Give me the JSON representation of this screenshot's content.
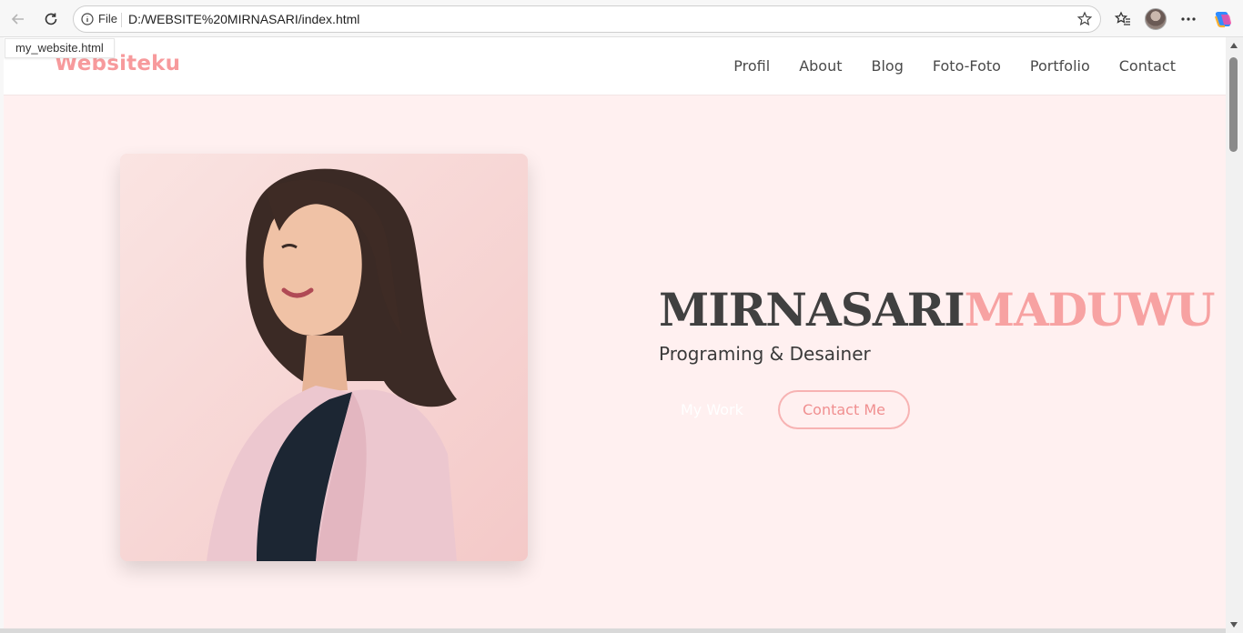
{
  "browser": {
    "info_label": "File",
    "url": "D:/WEBSITE%20MIRNASARI/index.html",
    "tooltip": "my_website.html"
  },
  "site": {
    "logo": "Websiteku",
    "nav": [
      "Profil",
      "About",
      "Blog",
      "Foto-Foto",
      "Portfolio",
      "Contact"
    ],
    "hero": {
      "first_name": "MIRNASARI",
      "last_name": "MADUWU",
      "tagline": "Programing & Desainer",
      "work_button": "My Work",
      "contact_button": "Contact Me"
    }
  },
  "colors": {
    "accent": "#f79a9c",
    "hero_bg": "#fff0f0",
    "text_dark": "#404040"
  }
}
